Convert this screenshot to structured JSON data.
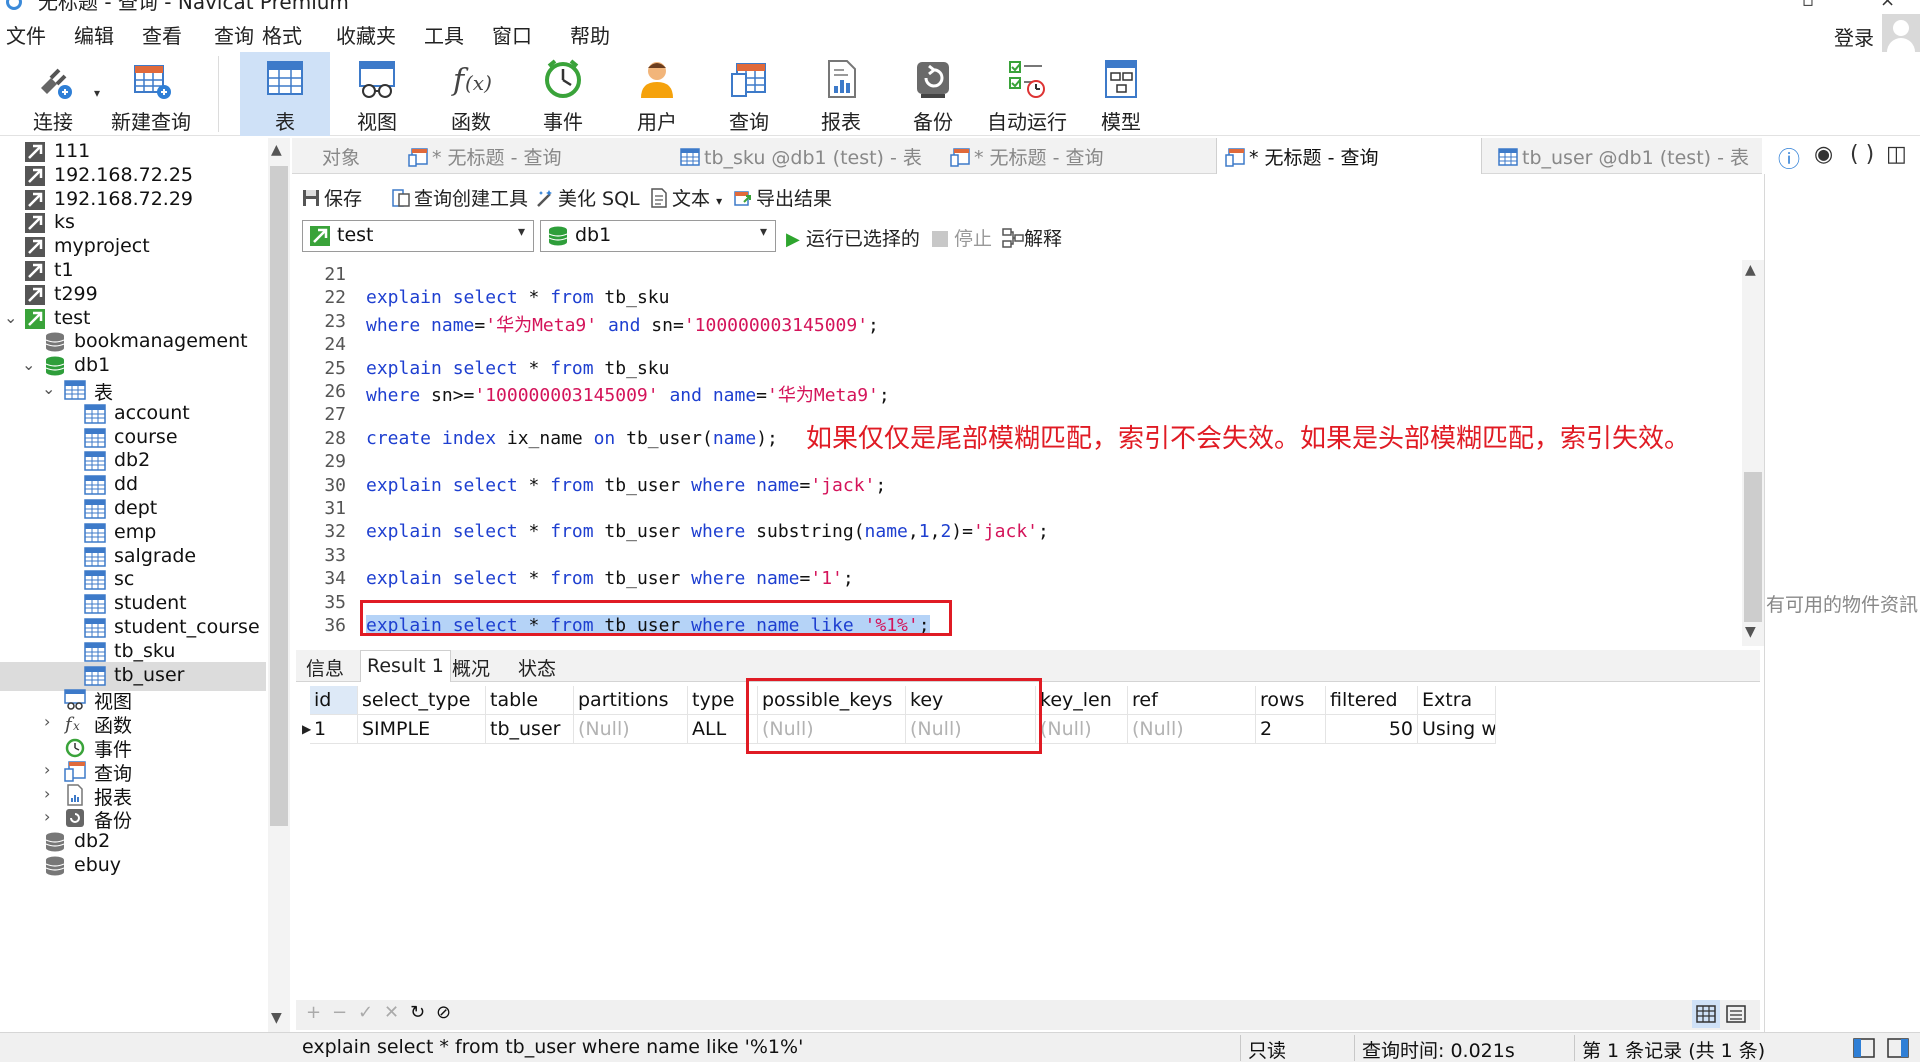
{
  "window": {
    "title": "无标题 - 查询 - Navicat Premium"
  },
  "menu": [
    "文件",
    "编辑",
    "查看",
    "查询",
    "格式",
    "收藏夹",
    "工具",
    "窗口",
    "帮助"
  ],
  "account": {
    "login_label": "登录"
  },
  "toolbar": {
    "connect": "连接",
    "new_query": "新建查询",
    "table": "表",
    "view": "视图",
    "function": "函数",
    "event": "事件",
    "user": "用户",
    "query": "查询",
    "report": "报表",
    "backup": "备份",
    "auto_run": "自动运行",
    "model": "模型"
  },
  "tree": {
    "connections": [
      "111",
      "192.168.72.25",
      "192.168.72.29",
      "ks",
      "myproject",
      "t1",
      "t299"
    ],
    "open_connection": "test",
    "databases_before": [
      "bookmanagement"
    ],
    "open_database": "db1",
    "tables_folder": "表",
    "tables": [
      "account",
      "course",
      "db2",
      "dd",
      "dept",
      "emp",
      "salgrade",
      "sc",
      "student",
      "student_course",
      "tb_sku",
      "tb_user"
    ],
    "selected_table": "tb_user",
    "folders": [
      "视图",
      "函数",
      "事件",
      "查询",
      "报表",
      "备份"
    ],
    "databases_after": [
      "db2",
      "ebuy"
    ]
  },
  "tabs": [
    {
      "label": "对象",
      "active": false
    },
    {
      "label": "* 无标题 - 查询",
      "active": false
    },
    {
      "label": "tb_sku @db1 (test) - 表",
      "active": false
    },
    {
      "label": "* 无标题 - 查询",
      "active": false
    },
    {
      "label": "* 无标题 - 查询",
      "active": true
    },
    {
      "label": "tb_user @db1 (test) - 表",
      "active": false
    }
  ],
  "query_toolbar": {
    "save": "保存",
    "builder": "查询创建工具",
    "beautify": "美化 SQL",
    "text": "文本",
    "export": "导出结果",
    "connection": "test",
    "database": "db1",
    "run_selected": "运行已选择的",
    "stop": "停止",
    "explain": "解释"
  },
  "editor": {
    "lines": [
      {
        "n": "21",
        "code": []
      },
      {
        "n": "22",
        "code": [
          [
            "kw",
            "explain select"
          ],
          [
            "idf",
            " * "
          ],
          [
            "kw",
            "from"
          ],
          [
            "idf",
            " tb_sku"
          ]
        ]
      },
      {
        "n": "23",
        "code": [
          [
            "kw",
            "where"
          ],
          [
            "idf",
            " "
          ],
          [
            "kw",
            "name"
          ],
          [
            "idf",
            "="
          ],
          [
            "str",
            "'华为Meta9'"
          ],
          [
            "idf",
            " "
          ],
          [
            "kw",
            "and"
          ],
          [
            "idf",
            " sn="
          ],
          [
            "str",
            "'100000003145009'"
          ],
          [
            "idf",
            ";"
          ]
        ]
      },
      {
        "n": "24",
        "code": []
      },
      {
        "n": "25",
        "code": [
          [
            "kw",
            "explain select"
          ],
          [
            "idf",
            " * "
          ],
          [
            "kw",
            "from"
          ],
          [
            "idf",
            " tb_sku"
          ]
        ]
      },
      {
        "n": "26",
        "code": [
          [
            "kw",
            "where"
          ],
          [
            "idf",
            " sn>="
          ],
          [
            "str",
            "'100000003145009'"
          ],
          [
            "idf",
            " "
          ],
          [
            "kw",
            "and"
          ],
          [
            "idf",
            " "
          ],
          [
            "kw",
            "name"
          ],
          [
            "idf",
            "="
          ],
          [
            "str",
            "'华为Meta9'"
          ],
          [
            "idf",
            ";"
          ]
        ]
      },
      {
        "n": "27",
        "code": []
      },
      {
        "n": "28",
        "code": [
          [
            "kw",
            "create index"
          ],
          [
            "idf",
            " ix_name "
          ],
          [
            "kw",
            "on"
          ],
          [
            "idf",
            " tb_user("
          ],
          [
            "kw",
            "name"
          ],
          [
            "idf",
            ");"
          ]
        ]
      },
      {
        "n": "29",
        "code": []
      },
      {
        "n": "30",
        "code": [
          [
            "kw",
            "explain select"
          ],
          [
            "idf",
            " * "
          ],
          [
            "kw",
            "from"
          ],
          [
            "idf",
            " tb_user "
          ],
          [
            "kw",
            "where name"
          ],
          [
            "idf",
            "="
          ],
          [
            "str",
            "'jack'"
          ],
          [
            "idf",
            ";"
          ]
        ]
      },
      {
        "n": "31",
        "code": []
      },
      {
        "n": "32",
        "code": [
          [
            "kw",
            "explain select"
          ],
          [
            "idf",
            " * "
          ],
          [
            "kw",
            "from"
          ],
          [
            "idf",
            " tb_user "
          ],
          [
            "kw",
            "where"
          ],
          [
            "idf",
            " substring("
          ],
          [
            "kw",
            "name"
          ],
          [
            "idf",
            ","
          ],
          [
            "kw",
            "1"
          ],
          [
            "idf",
            ","
          ],
          [
            "kw",
            "2"
          ],
          [
            "idf",
            ")="
          ],
          [
            "str",
            "'jack'"
          ],
          [
            "idf",
            ";"
          ]
        ]
      },
      {
        "n": "33",
        "code": []
      },
      {
        "n": "34",
        "code": [
          [
            "kw",
            "explain select"
          ],
          [
            "idf",
            " * "
          ],
          [
            "kw",
            "from"
          ],
          [
            "idf",
            " tb_user "
          ],
          [
            "kw",
            "where name"
          ],
          [
            "idf",
            "="
          ],
          [
            "str",
            "'1'"
          ],
          [
            "idf",
            ";"
          ]
        ]
      },
      {
        "n": "35",
        "code": []
      },
      {
        "n": "36",
        "code": [
          [
            "kw",
            "explain select"
          ],
          [
            "idf",
            " * "
          ],
          [
            "kw",
            "from"
          ],
          [
            "idf",
            " tb_user "
          ],
          [
            "kw",
            "where name like"
          ],
          [
            "idf",
            " "
          ],
          [
            "str",
            "'%1%'"
          ],
          [
            "idf",
            ";"
          ]
        ],
        "selected": true
      }
    ],
    "annotation": "如果仅仅是尾部模糊匹配，索引不会失效。如果是头部模糊匹配，索引失效。",
    "side_note": "有可用的物件资訊"
  },
  "result_tabs": [
    {
      "label": "信息",
      "active": false
    },
    {
      "label": "Result 1",
      "active": true
    },
    {
      "label": "概况",
      "active": false
    },
    {
      "label": "状态",
      "active": false
    }
  ],
  "grid": {
    "columns": [
      "id",
      "select_type",
      "table",
      "partitions",
      "type",
      "possible_keys",
      "key",
      "key_len",
      "ref",
      "rows",
      "filtered",
      "Extra"
    ],
    "rows": [
      [
        "1",
        "SIMPLE",
        "tb_user",
        "(Null)",
        "ALL",
        "(Null)",
        "(Null)",
        "(Null)",
        "(Null)",
        "2",
        "50",
        "Using wl"
      ]
    ]
  },
  "status": {
    "sql": "explain select * from tb_user where name like '%1%'",
    "readonly": "只读",
    "query_time": "查询时间: 0.021s",
    "records": "第 1 条记录 (共 1 条)"
  }
}
